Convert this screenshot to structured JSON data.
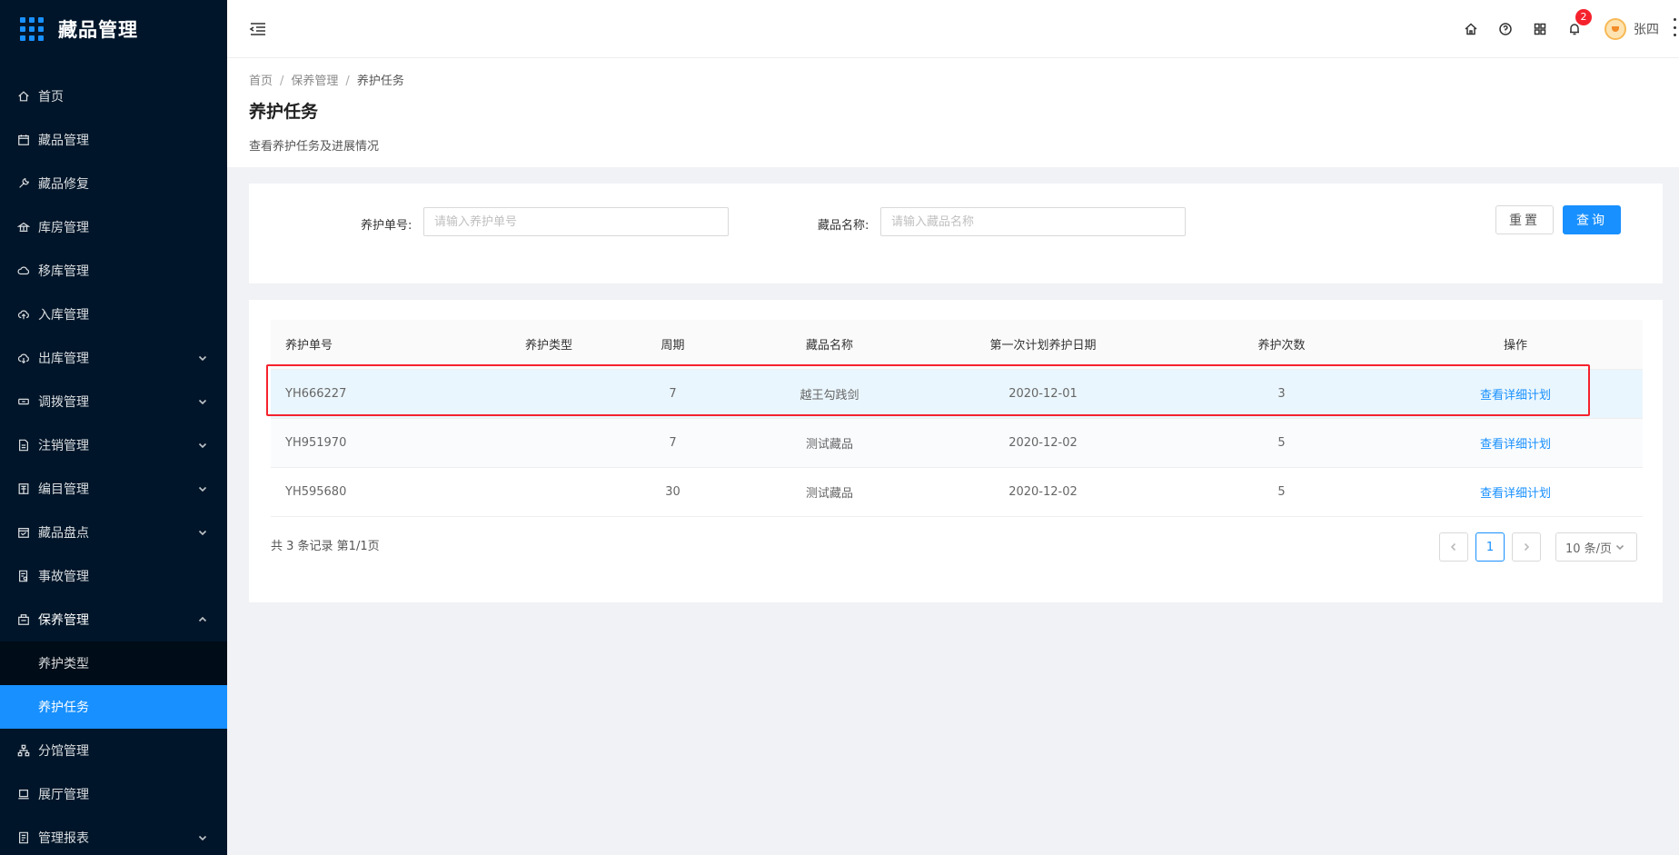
{
  "app": {
    "title": "藏品管理"
  },
  "sidebar": {
    "items": [
      {
        "label": "首页",
        "icon": "home-icon"
      },
      {
        "label": "藏品管理",
        "icon": "calendar-icon"
      },
      {
        "label": "藏品修复",
        "icon": "tool-icon"
      },
      {
        "label": "库房管理",
        "icon": "bank-icon"
      },
      {
        "label": "移库管理",
        "icon": "cloud-sync-icon"
      },
      {
        "label": "入库管理",
        "icon": "cloud-upload-icon"
      },
      {
        "label": "出库管理",
        "icon": "cloud-download-icon"
      },
      {
        "label": "调拨管理",
        "icon": "swap-icon"
      },
      {
        "label": "注销管理",
        "icon": "file-icon"
      },
      {
        "label": "编目管理",
        "icon": "book-icon"
      },
      {
        "label": "藏品盘点",
        "icon": "schedule-icon"
      },
      {
        "label": "事故管理",
        "icon": "audit-icon"
      },
      {
        "label": "保养管理",
        "icon": "build-icon"
      },
      {
        "label": "分馆管理",
        "icon": "cluster-icon"
      },
      {
        "label": "展厅管理",
        "icon": "laptop-icon"
      },
      {
        "label": "管理报表",
        "icon": "report-icon"
      }
    ],
    "submenu": [
      {
        "label": "养护类型"
      },
      {
        "label": "养护任务"
      }
    ]
  },
  "header": {
    "notification_count": "2",
    "user_name": "张四"
  },
  "breadcrumb": [
    "首页",
    "保养管理",
    "养护任务"
  ],
  "page": {
    "title": "养护任务",
    "description": "查看养护任务及进展情况"
  },
  "search": {
    "order_label": "养护单号:",
    "order_placeholder": "请输入养护单号",
    "name_label": "藏品名称:",
    "name_placeholder": "请输入藏品名称",
    "reset_label": "重置",
    "query_label": "查询"
  },
  "table": {
    "columns": [
      "养护单号",
      "养护类型",
      "周期",
      "藏品名称",
      "第一次计划养护日期",
      "养护次数",
      "操作"
    ],
    "rows": [
      {
        "id": "YH666227",
        "type": "",
        "cycle": "7",
        "name": "越王勾践剑",
        "date": "2020-12-01",
        "count": "3",
        "action": "查看详细计划"
      },
      {
        "id": "YH951970",
        "type": "",
        "cycle": "7",
        "name": "测试藏品",
        "date": "2020-12-02",
        "count": "5",
        "action": "查看详细计划"
      },
      {
        "id": "YH595680",
        "type": "",
        "cycle": "30",
        "name": "测试藏品",
        "date": "2020-12-02",
        "count": "5",
        "action": "查看详细计划"
      }
    ]
  },
  "pagination": {
    "total_text": "共 3 条记录 第1/1页",
    "current_page": "1",
    "page_size": "10 条/页"
  }
}
